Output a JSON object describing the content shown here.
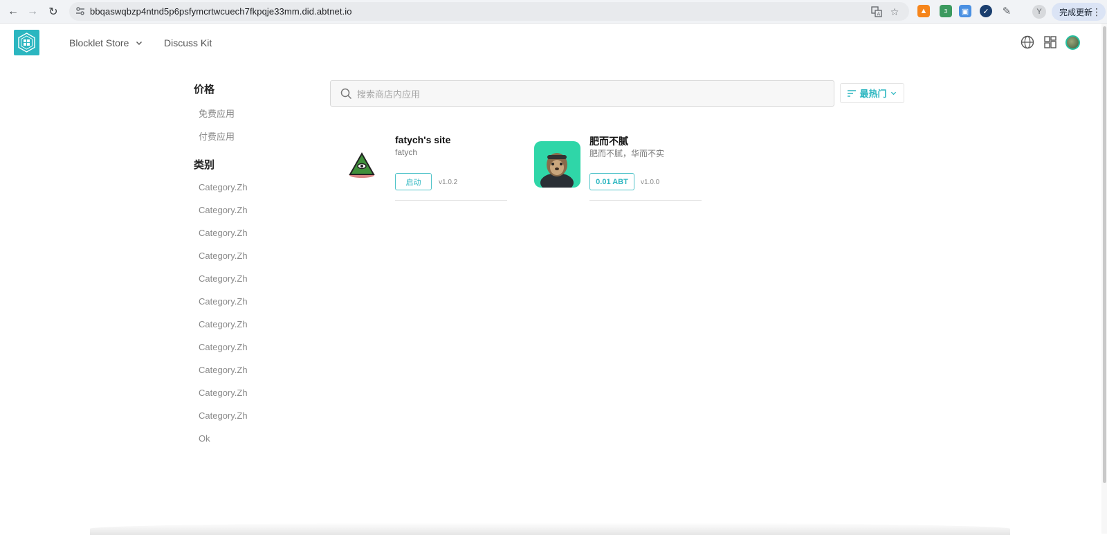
{
  "browser": {
    "url": "bbqaswqbzp4ntnd5p6psfymcrtwcuech7fkpqje33mm.did.abtnet.io",
    "profile_initial": "Y",
    "update_label": "完成更新",
    "extension_badge": "3"
  },
  "header": {
    "nav": [
      {
        "label": "Blocklet Store"
      },
      {
        "label": "Discuss Kit"
      }
    ]
  },
  "sidebar": {
    "price_heading": "价格",
    "price_items": [
      {
        "label": "免费应用"
      },
      {
        "label": "付费应用"
      }
    ],
    "category_heading": "类别",
    "category_items": [
      {
        "label": "Category.Zh"
      },
      {
        "label": "Category.Zh"
      },
      {
        "label": "Category.Zh"
      },
      {
        "label": "Category.Zh"
      },
      {
        "label": "Category.Zh"
      },
      {
        "label": "Category.Zh"
      },
      {
        "label": "Category.Zh"
      },
      {
        "label": "Category.Zh"
      },
      {
        "label": "Category.Zh"
      },
      {
        "label": "Category.Zh"
      },
      {
        "label": "Category.Zh"
      },
      {
        "label": "Ok"
      }
    ]
  },
  "search": {
    "placeholder": "搜索商店内应用",
    "value": ""
  },
  "sort": {
    "label": "最热门"
  },
  "apps": [
    {
      "title": "fatych's site",
      "subtitle": "fatych",
      "action": "启动",
      "version": "v1.0.2"
    },
    {
      "title": "肥而不腻",
      "subtitle": "肥而不腻，华而不实",
      "action": "0.01 ABT",
      "version": "v1.0.0"
    }
  ],
  "colors": {
    "accent": "#2bb6c0",
    "card_border": "#4fc3c9"
  }
}
